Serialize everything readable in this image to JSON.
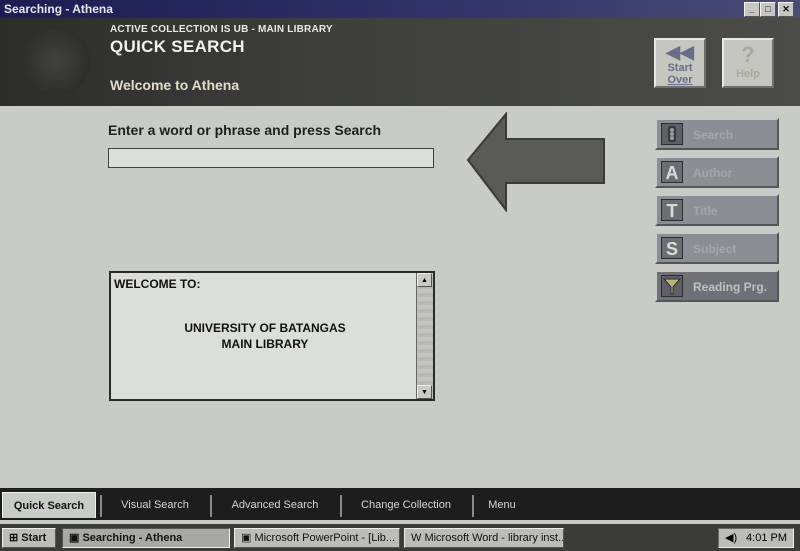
{
  "window": {
    "title": "Searching - Athena"
  },
  "header": {
    "collection": "ACTIVE COLLECTION IS UB - MAIN LIBRARY",
    "page_title": "QUICK SEARCH",
    "welcome": "Welcome to Athena",
    "start_over": {
      "line1": "Start",
      "line2": "Over"
    },
    "help": "Help"
  },
  "main": {
    "prompt": "Enter a word or phrase and press Search",
    "search_value": ""
  },
  "welcome_box": {
    "heading": "WELCOME TO:",
    "line1": "UNIVERSITY OF BATANGAS",
    "line2": "MAIN LIBRARY"
  },
  "side_buttons": [
    {
      "icon": "",
      "label": "Search"
    },
    {
      "icon": "A",
      "label": "Author"
    },
    {
      "icon": "T",
      "label": "Title"
    },
    {
      "icon": "S",
      "label": "Subject"
    },
    {
      "icon": "",
      "label": "Reading Prg."
    }
  ],
  "tabs": [
    "Quick Search",
    "Visual Search",
    "Advanced Search",
    "Change Collection",
    "Menu"
  ],
  "taskbar": {
    "start": "Start",
    "items": [
      "Searching - Athena",
      "Microsoft PowerPoint - [Lib...",
      "Microsoft Word - library inst..."
    ],
    "clock": "4:01 PM"
  }
}
